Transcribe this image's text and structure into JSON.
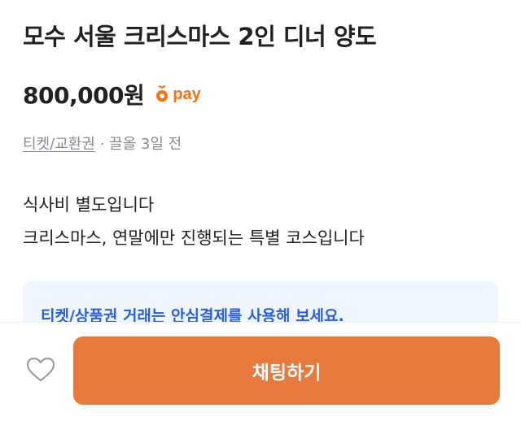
{
  "product": {
    "title": "모수 서울 크리스마스 2인 디너 양도",
    "price": "800,000원",
    "pay_label": "pay",
    "category": "티켓/교환권",
    "separator": " · ",
    "posted_info": "끌올 3일 전"
  },
  "description": {
    "lines": [
      "식사비 별도입니다",
      "크리스마스, 연말에만 진행되는 특별 코스입니다"
    ]
  },
  "notice": {
    "text": "티켓/상품권 거래는 안심결제를 사용해 보세요."
  },
  "bottom_bar": {
    "chat_button_label": "채팅하기"
  },
  "colors": {
    "brand_orange": "#ff6f0f",
    "chat_button": "#e8793c",
    "notice_bg": "#f0f6ff",
    "notice_text": "#2a5fd8",
    "meta_text": "#868b94"
  },
  "icons": {
    "pay_logo": "carrot-pay-icon",
    "like": "heart-outline-icon"
  }
}
